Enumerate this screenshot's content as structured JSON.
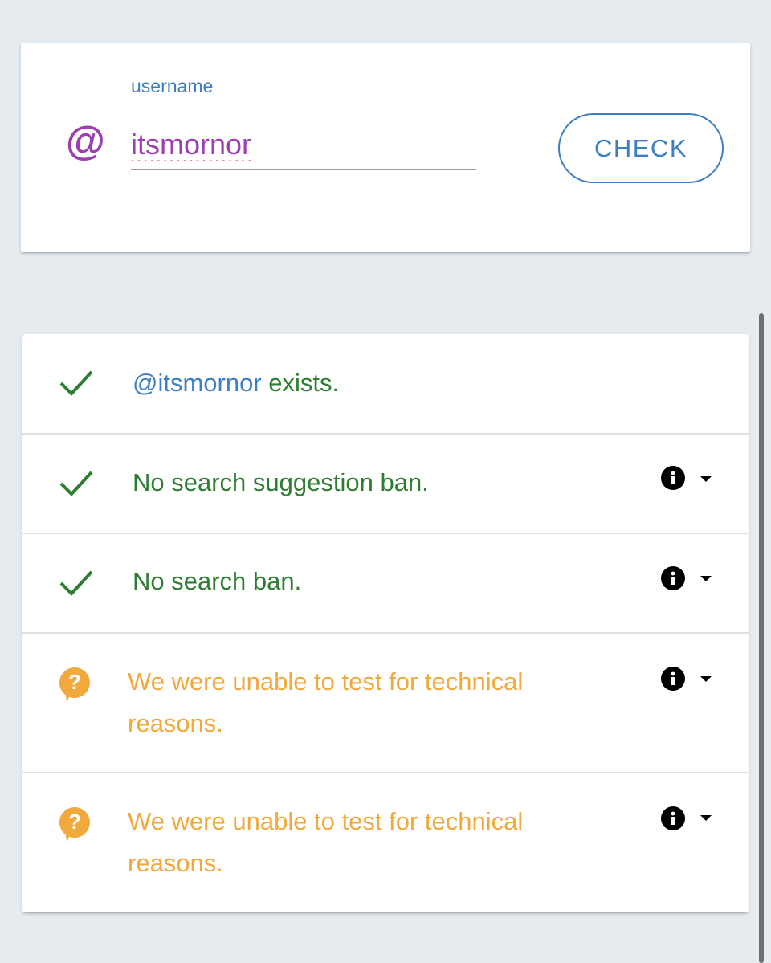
{
  "search": {
    "at_symbol": "@",
    "label": "username",
    "value": "itsmornor",
    "button_label": "CHECK"
  },
  "results": [
    {
      "status": "ok",
      "icon": "check-icon",
      "handle": "@itsmornor",
      "text": " exists."
    },
    {
      "status": "ok",
      "icon": "check-icon",
      "text": "No search suggestion ban.",
      "info": true
    },
    {
      "status": "ok",
      "icon": "check-icon",
      "text": "No search ban.",
      "info": true
    },
    {
      "status": "unknown",
      "icon": "help-bubble-icon",
      "text_line1": "We were unable to test for technical",
      "text_line2": "reasons.",
      "info": true
    },
    {
      "status": "unknown",
      "icon": "help-bubble-icon",
      "text_line1": "We were unable to test for technical",
      "text_line2": "reasons.",
      "info": true
    }
  ],
  "colors": {
    "accent_blue": "#3d7fbf",
    "purple": "#9c3fb0",
    "success_green": "#2e7d32",
    "warning_orange": "#f2a93b"
  }
}
